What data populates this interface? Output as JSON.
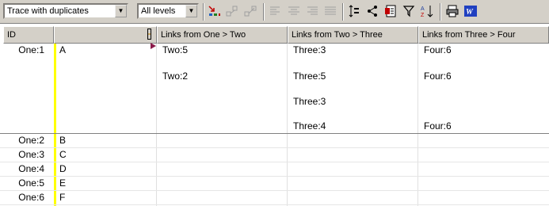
{
  "toolbar": {
    "trace_mode": "Trace with duplicates",
    "levels": "All levels",
    "icons": [
      "reduce-icon",
      "expand-icon",
      "collapse-icon",
      "align-left-icon",
      "align-center-icon",
      "align-right-icon",
      "justify-icon",
      "row-height-icon",
      "link-icon",
      "report-icon",
      "filter-icon",
      "sort-icon",
      "print-icon",
      "word-icon"
    ]
  },
  "grid": {
    "headers": [
      "ID",
      "",
      "Links from One > Two",
      "Links from Two > Three",
      "Links from Three > Four"
    ],
    "rows": [
      {
        "id": "One:1",
        "name": "A",
        "two": [
          "Two:5",
          "Two:2"
        ],
        "three": [
          "Three:3",
          "Three:5",
          "Three:3",
          "Three:4"
        ],
        "four": [
          "Four:6",
          "Four:6",
          "",
          "Four:6"
        ]
      },
      {
        "id": "One:2",
        "name": "B"
      },
      {
        "id": "One:3",
        "name": "C"
      },
      {
        "id": "One:4",
        "name": "D"
      },
      {
        "id": "One:5",
        "name": "E"
      },
      {
        "id": "One:6",
        "name": "F"
      }
    ]
  },
  "colors": {
    "accent_bar": "#ffff00",
    "marker": "#8b1a4a"
  }
}
